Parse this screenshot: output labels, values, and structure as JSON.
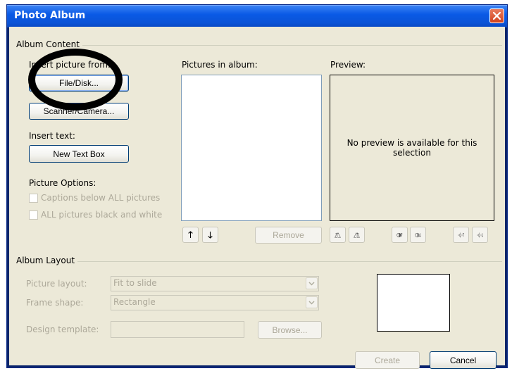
{
  "window": {
    "title": "Photo Album"
  },
  "album_content": {
    "group_label": "Album Content",
    "insert_picture_label": "Insert picture from:",
    "file_disk_button": "File/Disk...",
    "scanner_camera_button": "Scanner/Camera...",
    "insert_text_label": "Insert text:",
    "new_text_box_button": "New Text Box",
    "picture_options_label": "Picture Options:",
    "captions_option": "Captions below ALL pictures",
    "black_white_option": "ALL pictures black and white",
    "pictures_in_album_label": "Pictures in album:",
    "preview_label": "Preview:",
    "preview_text": "No preview is available for this selection",
    "remove_button": "Remove"
  },
  "album_layout": {
    "group_label": "Album Layout",
    "picture_layout_label": "Picture layout:",
    "picture_layout_value": "Fit to slide",
    "frame_shape_label": "Frame shape:",
    "frame_shape_value": "Rectangle",
    "design_template_label": "Design template:",
    "design_template_value": "",
    "browse_button": "Browse..."
  },
  "footer": {
    "create_button": "Create",
    "cancel_button": "Cancel"
  },
  "icons": {
    "move_up": "arrow-up-icon",
    "move_down": "arrow-down-icon",
    "rotate_left": "rotate-left-icon",
    "rotate_right": "rotate-right-icon",
    "contrast_up": "contrast-increase-icon",
    "contrast_down": "contrast-decrease-icon",
    "brightness_up": "brightness-increase-icon",
    "brightness_down": "brightness-decrease-icon"
  },
  "colors": {
    "titlebar": "#0A5AE6",
    "dialog_bg": "#ECE9D8",
    "disabled_text": "#ACA899",
    "annotation": "#000000"
  }
}
